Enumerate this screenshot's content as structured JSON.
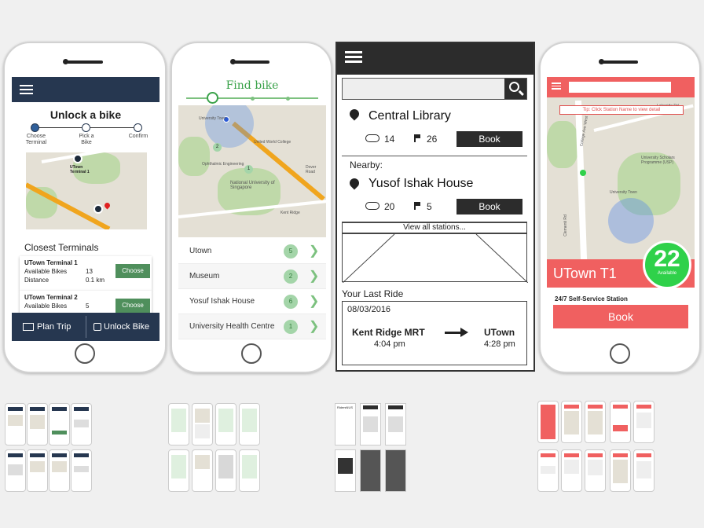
{
  "phone1": {
    "title": "Unlock a bike",
    "steps": [
      "Choose Terminal",
      "Pick a Bike",
      "Confirm"
    ],
    "map_label": "UTown Terminal 1",
    "section_title": "Closest Terminals",
    "terminals": [
      {
        "name": "UTown Terminal 1",
        "bikes_label": "Available Bikes",
        "bikes": "13",
        "distance_label": "Distance",
        "distance": "0.1 km",
        "button": "Choose"
      },
      {
        "name": "UTown Terminal 2",
        "bikes_label": "Available Bikes",
        "bikes": "5",
        "button": "Choose"
      }
    ],
    "plan_trip": "Plan Trip",
    "unlock_bike": "Unlock Bike",
    "colors": {
      "primary": "#263750",
      "accent": "#4f8f5c"
    }
  },
  "phone2": {
    "title": "Find bike",
    "map_labels": [
      "University Town",
      "United World College",
      "Ophthalmic Engineering",
      "National University of Singapore",
      "Kent Ridge",
      "Dover Road"
    ],
    "locations": [
      {
        "name": "Utown",
        "count": "5"
      },
      {
        "name": "Museum",
        "count": "2"
      },
      {
        "name": "Yosuf Ishak House",
        "count": "6"
      },
      {
        "name": "University Health Centre",
        "count": "1"
      }
    ],
    "colors": {
      "accent": "#3aa24a"
    }
  },
  "phone3": {
    "primary": {
      "name": "Central Library",
      "bikes": "14",
      "docks": "26",
      "button": "Book"
    },
    "nearby_label": "Nearby:",
    "nearby": {
      "name": "Yusof Ishak House",
      "bikes": "20",
      "docks": "5",
      "button": "Book"
    },
    "view_all": "View all stations...",
    "last_ride_label": "Your Last Ride",
    "last_ride": {
      "date": "08/03/2016",
      "from": "Kent Ridge MRT",
      "from_time": "4:04 pm",
      "to": "UTown",
      "to_time": "4:28 pm"
    }
  },
  "phone4": {
    "tip": "Tip: Click Station Name to view detail",
    "map_labels": [
      "College Ave West",
      "University Scholars Programme (USP)",
      "University Town",
      "Clementi Rd",
      "Lakeside Rd"
    ],
    "station": "UTown T1",
    "available_count": "22",
    "available_label": "Available",
    "service": "24/7 Self-Service Station",
    "button": "Book",
    "colors": {
      "primary": "#f06060",
      "available": "#2fd14a"
    }
  },
  "thumbnail_groups": [
    {
      "name": "Design 1 screens"
    },
    {
      "name": "Design 2 screens"
    },
    {
      "name": "Design 3 screens",
      "visible_text": "RidersNUS"
    },
    {
      "name": "Design 4 screens"
    }
  ]
}
